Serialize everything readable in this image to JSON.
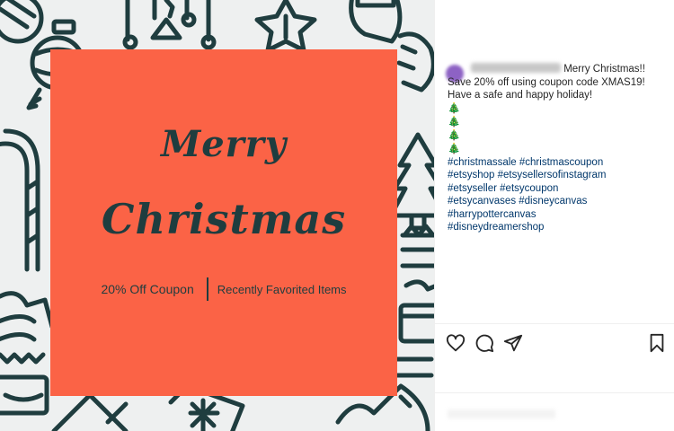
{
  "post": {
    "image": {
      "background_color": "#eef0f0",
      "doodle_color": "#1f3d3f",
      "card_color": "#fb6346",
      "title_line1": "Merry",
      "title_line2": "Christmas",
      "link_left": "20% Off Coupon",
      "link_right": "Recently Favorited Items"
    },
    "caption": {
      "message": "Merry Christmas!! Save 20% off using coupon code XMAS19! Have a safe and happy holiday!",
      "tree_emojis": [
        "🎄",
        "🎄",
        "🎄",
        "🎄"
      ],
      "hashtags": [
        "#christmassale #christmascoupon",
        "#etsyshop #etsysellersofinstagram",
        "#etsyseller #etsycoupon",
        "#etsycanvases #disneycanvas",
        "#harrypottercanvas",
        "#disneydreamershop"
      ],
      "hashtag_color": "#00376b"
    },
    "actions": {
      "icons": [
        "heart-icon",
        "comment-icon",
        "share-icon",
        "bookmark-icon"
      ]
    }
  }
}
